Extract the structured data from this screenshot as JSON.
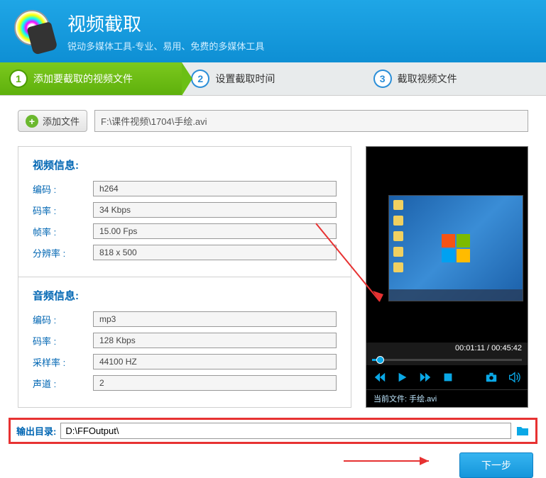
{
  "header": {
    "title": "视频截取",
    "subtitle": "锐动多媒体工具-专业、易用、免费的多媒体工具"
  },
  "steps": [
    {
      "num": "1",
      "label": "添加要截取的视频文件"
    },
    {
      "num": "2",
      "label": "设置截取时间"
    },
    {
      "num": "3",
      "label": "截取视频文件"
    }
  ],
  "add_button": "添加文件",
  "file_path": "F:\\课件视频\\1704\\手绘.avi",
  "video_info": {
    "title": "视频信息:",
    "codec_label": "编码 :",
    "codec": "h264",
    "bitrate_label": "码率 :",
    "bitrate": "34 Kbps",
    "fps_label": "帧率 :",
    "fps": "15.00 Fps",
    "res_label": "分辨率 :",
    "res": "818 x 500"
  },
  "audio_info": {
    "title": "音频信息:",
    "codec_label": "编码 :",
    "codec": "mp3",
    "bitrate_label": "码率 :",
    "bitrate": "128 Kbps",
    "sample_label": "采样率 :",
    "sample": "44100 HZ",
    "channel_label": "声道 :",
    "channel": "2"
  },
  "player": {
    "time": "00:01:11 / 00:45:42",
    "current_file_label": "当前文件:",
    "current_file": "手绘.avi"
  },
  "output": {
    "label": "输出目录:",
    "path": "D:\\FFOutput\\"
  },
  "next_button": "下一步"
}
